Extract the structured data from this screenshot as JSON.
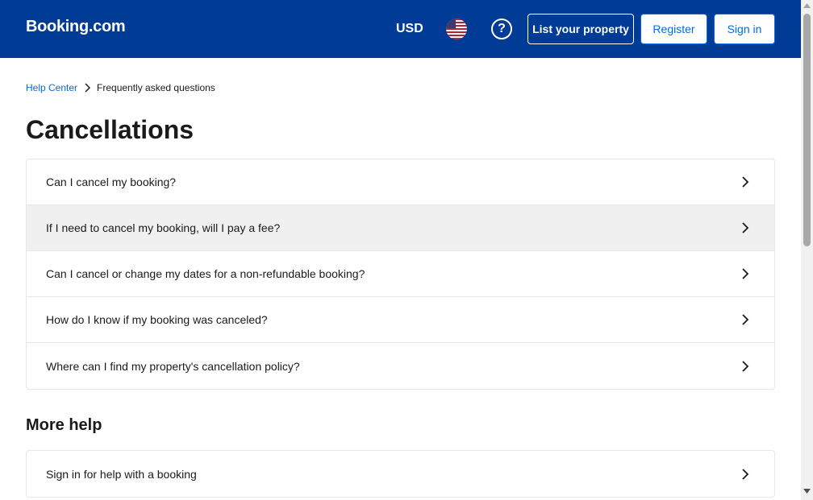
{
  "header": {
    "logo": "Booking.com",
    "currency": "USD",
    "flag_icon": "us-flag-icon",
    "help_icon_glyph": "?",
    "list_property_label": "List your property",
    "register_label": "Register",
    "signin_label": "Sign in",
    "brand_color": "#003b95",
    "link_color": "#006ce4"
  },
  "breadcrumb": {
    "home": "Help Center",
    "current": "Frequently asked questions"
  },
  "title": "Cancellations",
  "faqs": [
    {
      "question": "Can I cancel my booking?"
    },
    {
      "question": "If I need to cancel my booking, will I pay a fee?"
    },
    {
      "question": "Can I cancel or change my dates for a non-refundable booking?"
    },
    {
      "question": "How do I know if my booking was canceled?"
    },
    {
      "question": "Where can I find my property's cancellation policy?"
    }
  ],
  "more_help": {
    "title": "More help",
    "items": [
      {
        "label": "Sign in for help with a booking"
      }
    ]
  }
}
